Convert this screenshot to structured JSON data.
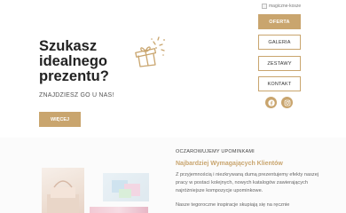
{
  "header": {
    "logo_alt": "magiczne-kosze"
  },
  "nav": {
    "items": [
      {
        "label": "OFERTA"
      },
      {
        "label": "GALERIA"
      },
      {
        "label": "ZESTAWY"
      },
      {
        "label": "KONTAKT"
      }
    ]
  },
  "social": {
    "facebook_icon": "facebook-icon",
    "instagram_icon": "instagram-icon"
  },
  "hero": {
    "headline": "Szukasz idealnego prezentu?",
    "tagline": "ZNAJDZIESZ GO U NAS!",
    "cta_label": "WIĘCEJ",
    "gift_icon": "gift-icon"
  },
  "section": {
    "label": "OCZAROWUJEMY UPOMINKAMI",
    "title": "Najbardziej Wymagających Klientów",
    "paragraph1": "Z przyjemnością i niezkrywaną dumą prezentujemy efekty naszej pracy w postaci kolejnych, nowych katalogów zawierających najróżniejsze kompozycje upominkowe.",
    "paragraph2": "Nasze tegoroczne inspiracje skupiają się na ręcznie"
  },
  "colors": {
    "accent": "#c9a56e",
    "title_gold": "#c9a56e"
  }
}
